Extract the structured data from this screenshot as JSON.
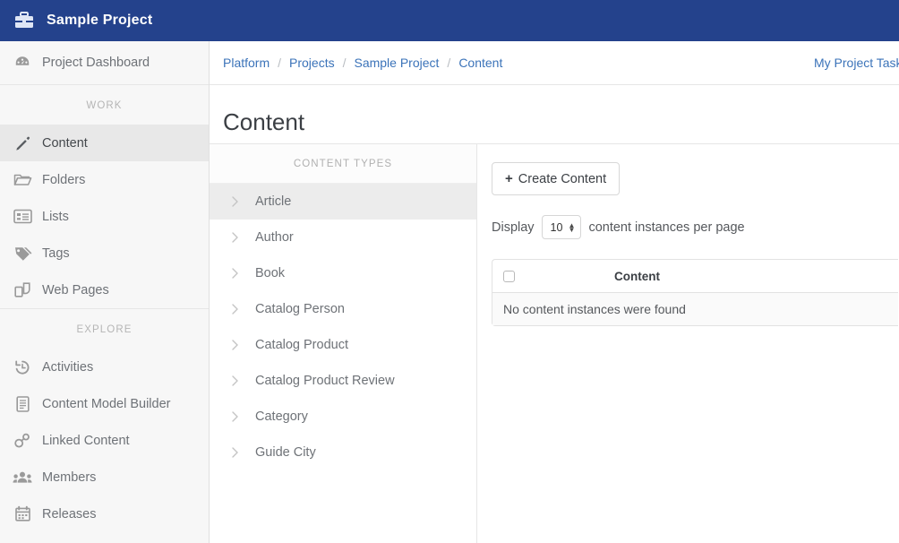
{
  "topbar": {
    "icon": "briefcase-icon",
    "title": "Sample Project"
  },
  "sidebar": {
    "dashboard": {
      "label": "Project Dashboard",
      "icon": "dashboard-gauge-icon"
    },
    "sections": [
      {
        "label": "WORK",
        "items": [
          {
            "label": "Content",
            "icon": "pencil-icon",
            "active": true
          },
          {
            "label": "Folders",
            "icon": "folder-icon",
            "active": false
          },
          {
            "label": "Lists",
            "icon": "list-icon",
            "active": false
          },
          {
            "label": "Tags",
            "icon": "tag-icon",
            "active": false
          },
          {
            "label": "Web Pages",
            "icon": "pages-icon",
            "active": false
          }
        ]
      },
      {
        "label": "EXPLORE",
        "items": [
          {
            "label": "Activities",
            "icon": "history-icon",
            "active": false
          },
          {
            "label": "Content Model Builder",
            "icon": "document-icon",
            "active": false
          },
          {
            "label": "Linked Content",
            "icon": "link-icon",
            "active": false
          },
          {
            "label": "Members",
            "icon": "people-icon",
            "active": false
          },
          {
            "label": "Releases",
            "icon": "calendar-icon",
            "active": false
          }
        ]
      }
    ]
  },
  "breadcrumb": {
    "items": [
      "Platform",
      "Projects",
      "Sample Project",
      "Content"
    ],
    "separator": "/",
    "right_link": "My Project Tasks"
  },
  "page": {
    "title": "Content"
  },
  "content_types": {
    "header": "CONTENT TYPES",
    "items": [
      {
        "label": "Article",
        "selected": true
      },
      {
        "label": "Author",
        "selected": false
      },
      {
        "label": "Book",
        "selected": false
      },
      {
        "label": "Catalog Person",
        "selected": false
      },
      {
        "label": "Catalog Product",
        "selected": false
      },
      {
        "label": "Catalog Product Review",
        "selected": false
      },
      {
        "label": "Category",
        "selected": false
      },
      {
        "label": "Guide City",
        "selected": false
      }
    ]
  },
  "work": {
    "create_button": "Create Content",
    "create_plus": "+",
    "display_prefix": "Display",
    "page_size_value": "10",
    "display_suffix": "content instances per page",
    "table": {
      "column_header": "Content",
      "empty_message": "No content instances were found"
    }
  },
  "colors": {
    "topbar_blue": "#24428c",
    "link_blue": "#3b73b9",
    "sidebar_bg": "#f7f7f7",
    "active_bg": "#e8e8e8"
  }
}
